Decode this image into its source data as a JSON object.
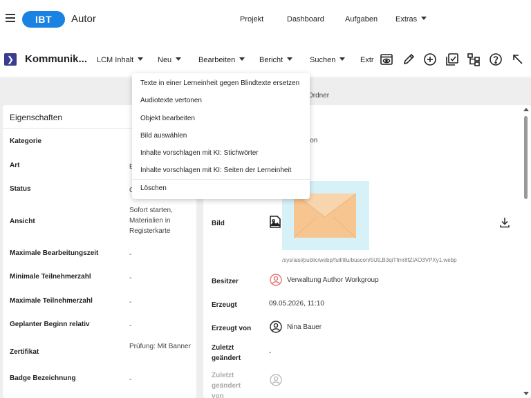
{
  "header": {
    "logo": "IBT",
    "app_name": "Autor",
    "nav": {
      "projekt": "Projekt",
      "dashboard": "Dashboard",
      "aufgaben": "Aufgaben",
      "extras": "Extras"
    }
  },
  "toolbar": {
    "title": "Kommunik...",
    "menus": {
      "lcm": "LCM Inhalt",
      "neu": "Neu",
      "bearbeiten": "Bearbeiten",
      "bericht": "Bericht",
      "suchen": "Suchen",
      "extr": "Extr"
    },
    "icons": [
      "preview-icon",
      "pencil-icon",
      "plus-circle-icon",
      "checklist-icon",
      "hierarchy-icon",
      "help-icon",
      "collapse-arrow-icon"
    ]
  },
  "background": {
    "tab_text": "Ordner"
  },
  "dropdown": {
    "items": [
      "Texte in einer Lerneinheit gegen Blindtexte ersetzen",
      "Audiotexte vertonen",
      "Objekt bearbeiten",
      "Bild auswählen",
      "Inhalte vorschlagen mit KI: Stichwörter",
      "Inhalte vorschlagen mit KI: Seiten der Lerneinheit",
      "Löschen"
    ]
  },
  "properties": {
    "title": "Eigenschaften",
    "rows": [
      {
        "label": "Kategorie",
        "value": ""
      },
      {
        "label": "Art",
        "value": "E"
      },
      {
        "label": "Status",
        "value": "C"
      },
      {
        "label": "Ansicht",
        "value": "Sofort starten, Materialien in Registerkarte"
      },
      {
        "label": "Maximale Bearbeitungszeit",
        "value": "-"
      },
      {
        "label": "Minimale Teilnehmerzahl",
        "value": "-"
      },
      {
        "label": "Maximale Teilnehmerzahl",
        "value": "-"
      },
      {
        "label": "Geplanter Beginn relativ",
        "value": "-"
      },
      {
        "label": "Zertifikat",
        "value": "Prüfung: Mit Banner"
      },
      {
        "label": "Badge Bezeichnung",
        "value": "-"
      }
    ]
  },
  "details": {
    "top_text": "ion",
    "bild_label": "Bild",
    "image_path": "/sys/aisi/public/webp/full/illu/buscon/5UtLB3qiTfmr8fZIAO3VPXy1.webp",
    "besitzer_label": "Besitzer",
    "besitzer_value": "Verwaltung Author Workgroup",
    "erzeugt_label": "Erzeugt",
    "erzeugt_value": "09.05.2026, 11:10",
    "erzeugt_von_label": "Erzeugt von",
    "erzeugt_von_value": "Nina Bauer",
    "zuletzt_label": "Zuletzt geändert",
    "zuletzt_value": "-",
    "zuletzt_von_label": "Zuletzt geändert von"
  },
  "colors": {
    "brand": "#1a82e2",
    "accent_dark": "#3b3b8f",
    "envelope": "#f7c590",
    "image_bg": "#d6f2f8",
    "owner_icon": "#e57373"
  }
}
